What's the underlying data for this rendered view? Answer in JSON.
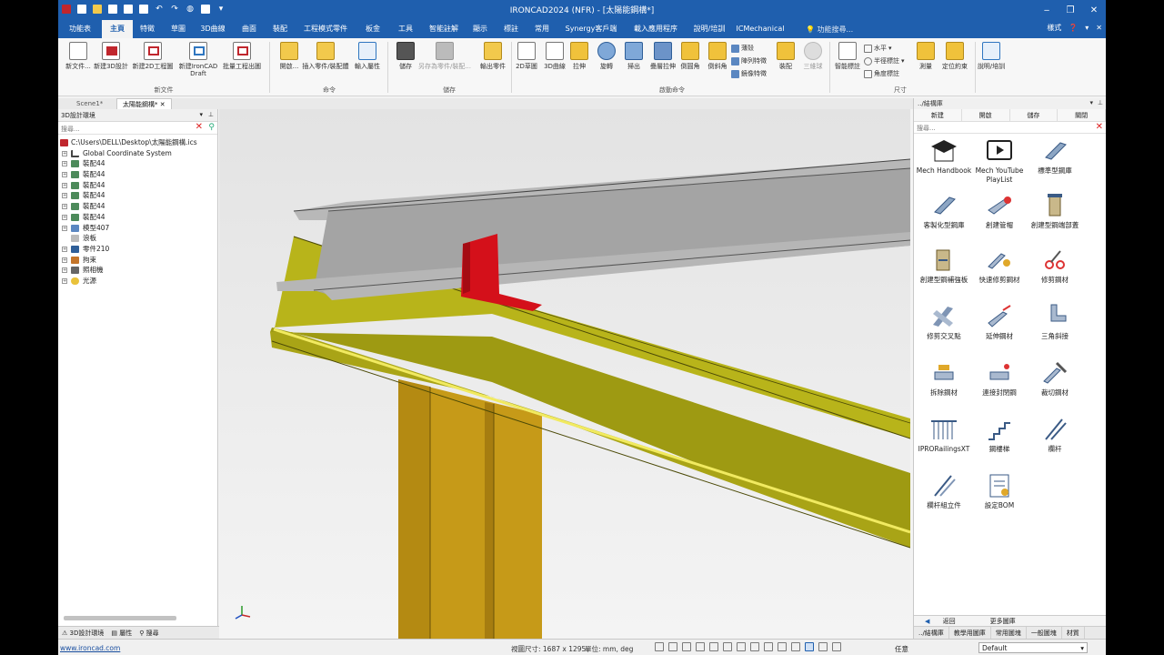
{
  "window": {
    "title": "IRONCAD2024 (NFR) - [太陽能鋼構*]",
    "minimize": "‒",
    "restore": "❐",
    "close": "✕"
  },
  "menu": {
    "tabs": [
      "功能表",
      "主頁",
      "特徵",
      "草圖",
      "3D曲線",
      "曲面",
      "裝配",
      "工程模式零件",
      "板金",
      "工具",
      "智能註解",
      "顯示",
      "標註",
      "常用",
      "Synergy客戶端",
      "載入應用程序",
      "說明/培訓",
      "ICMechanical"
    ],
    "active_tab": "主頁",
    "search_placeholder": "功能搜尋...",
    "style_label": "樣式"
  },
  "ribbon": {
    "groups": [
      "新文件",
      "命令",
      "儲存",
      "啟動命令",
      "尺寸"
    ],
    "buttons": {
      "new_file": "新文件...",
      "new_3d": "新建3D設計",
      "new_2d": "新建2D工程圖",
      "new_draft": "新建IronCAD Draft",
      "batch": "批量工程出圖",
      "open": "開啟...",
      "insert": "插入零件/裝配體",
      "import_attr": "輸入屬性",
      "save": "儲存",
      "save_as": "另存為零件/裝配...",
      "export": "輸出零件",
      "sketch2d": "2D草圖",
      "curve3d": "3D曲線",
      "extrude": "拉伸",
      "revolve": "旋轉",
      "sweep": "掃出",
      "loft": "疊層拉伸",
      "fillet": "倒圓角",
      "chamfer": "倒斜角",
      "assemble": "裝配",
      "tri_ball": "三維球",
      "smart_dim": "智能標註",
      "measure": "測量",
      "locate": "定位約束",
      "help": "說明/培訓"
    },
    "small": {
      "shell": "薄殼",
      "pattern": "陣列特徵",
      "mirror": "鏡像特徵",
      "horizontal": "水平",
      "radius": "半徑標註",
      "angle": "角度標註"
    }
  },
  "doc_tabs": [
    "Scene1*",
    "太陽能鋼構*"
  ],
  "left_pane": {
    "title": "3D設計環境",
    "search_placeholder": "搜尋...",
    "tree": [
      {
        "label": "C:\\Users\\DELL\\Desktop\\太陽能鋼構.ics",
        "level": 0
      },
      {
        "label": "Global Coordinate System",
        "level": 1
      },
      {
        "label": "裝配44",
        "level": 1
      },
      {
        "label": "裝配44",
        "level": 1
      },
      {
        "label": "裝配44",
        "level": 1
      },
      {
        "label": "裝配44",
        "level": 1
      },
      {
        "label": "裝配44",
        "level": 1
      },
      {
        "label": "裝配44",
        "level": 1
      },
      {
        "label": "模型407",
        "level": 1
      },
      {
        "label": "浪板",
        "level": 1
      },
      {
        "label": "零件210",
        "level": 1
      },
      {
        "label": "拘束",
        "level": 1
      },
      {
        "label": "照相機",
        "level": 1
      },
      {
        "label": "光源",
        "level": 1
      }
    ],
    "bottom_tabs": [
      "3D設計環境",
      "屬性",
      "搜尋"
    ]
  },
  "right_pane": {
    "title": "../結構庫",
    "tools": [
      "新建",
      "開啟",
      "儲存",
      "關閉"
    ],
    "search_placeholder": "搜尋...",
    "items": [
      {
        "label": "Mech Handbook",
        "icon": "graduation-cap-icon"
      },
      {
        "label": "Mech YouTube PlayList",
        "icon": "video-icon"
      },
      {
        "label": "標準型鋼庫",
        "icon": "beam-icon"
      },
      {
        "label": "客製化型鋼庫",
        "icon": "beam-custom-icon"
      },
      {
        "label": "創建管帽",
        "icon": "tube-cap-icon"
      },
      {
        "label": "創建型鋼端部蓋",
        "icon": "end-cap-icon"
      },
      {
        "label": "創建型鋼補強板",
        "icon": "stiffener-icon"
      },
      {
        "label": "快速修剪鋼材",
        "icon": "quick-trim-icon"
      },
      {
        "label": "修剪鋼材",
        "icon": "trim-scissors-icon"
      },
      {
        "label": "修剪交叉點",
        "icon": "trim-cross-icon"
      },
      {
        "label": "延伸鋼材",
        "icon": "extend-icon"
      },
      {
        "label": "三角斜接",
        "icon": "miter-icon"
      },
      {
        "label": "拆除鋼材",
        "icon": "remove-icon"
      },
      {
        "label": "連接封閉鋼",
        "icon": "connect-icon"
      },
      {
        "label": "裁切鋼材",
        "icon": "cut-icon"
      },
      {
        "label": "IPRORailingsXT",
        "icon": "railing-icon"
      },
      {
        "label": "鋼樓梯",
        "icon": "stairs-icon"
      },
      {
        "label": "欄杆",
        "icon": "handrail-icon"
      },
      {
        "label": "欄杆組立件",
        "icon": "handrail-assy-icon"
      },
      {
        "label": "設定BOM",
        "icon": "bom-icon"
      }
    ],
    "footer_nav": [
      "返回",
      "更多圖庫"
    ],
    "bottom_tabs": [
      "../結構庫",
      "教學用圖庫",
      "常用圖塊",
      "一般圖塊",
      "材質"
    ]
  },
  "status": {
    "url": "www.ironcad.com",
    "view_size": "視圖尺寸: 1687 x 1295",
    "unit": "單位:  mm, deg",
    "mode": "任意",
    "preset": "Default"
  },
  "colors": {
    "titlebar": "#1f5fae",
    "beam_grey": "#a4a4a4",
    "beam_yellow": "#9e9a12",
    "bracket_red": "#d4101a",
    "column_gold": "#c69a18"
  }
}
